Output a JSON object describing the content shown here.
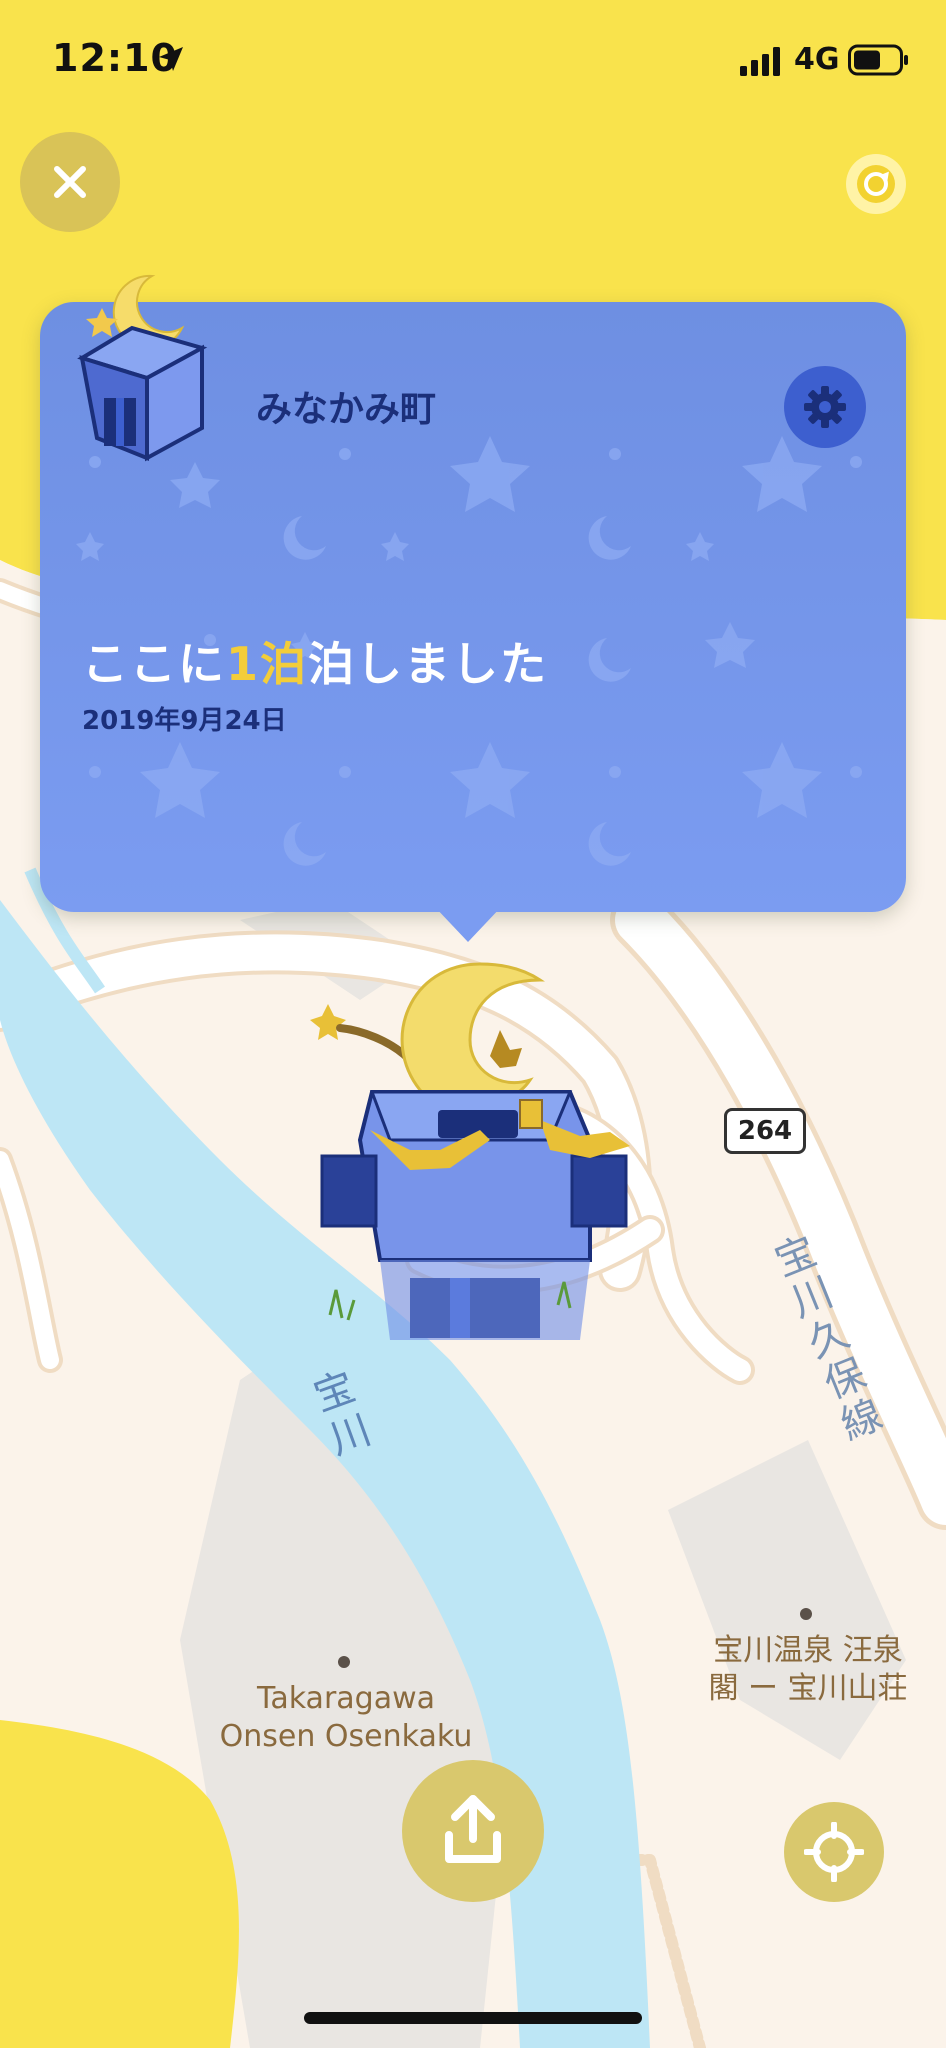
{
  "status_bar": {
    "time": "12:10",
    "network": "4G",
    "icons": [
      "location-arrow-icon",
      "signal-icon",
      "battery-icon"
    ]
  },
  "header": {
    "close_icon": "close-icon",
    "top_right_icon": "camera-rotate-icon"
  },
  "card": {
    "town_name": "みなかみ町",
    "stay_prefix": "ここに",
    "stay_count": "1",
    "stay_unit": "泊",
    "stay_suffix": "泊しました",
    "date": "2019年9月24日",
    "settings_icon": "gear-icon"
  },
  "map": {
    "route_number": "264",
    "road_name": "宝川久保線",
    "river_name": "宝川",
    "poi": [
      {
        "label_line1": "Takaragawa",
        "label_line2": "Onsen Osenkaku"
      },
      {
        "label_line1": "宝川温泉 汪泉",
        "label_line2": "閣 ー 宝川山荘"
      }
    ]
  },
  "footer": {
    "upload_icon": "upload-icon",
    "locate_icon": "crosshair-icon"
  },
  "colors": {
    "yellow_area": "#f9e34c",
    "card_blue": "#7293e8",
    "river": "#bde6f5",
    "land": "#fbf3ea",
    "building": "#e9e6e2",
    "accent_gold": "#f3cd3a",
    "dark_blue": "#1b2f7a"
  }
}
